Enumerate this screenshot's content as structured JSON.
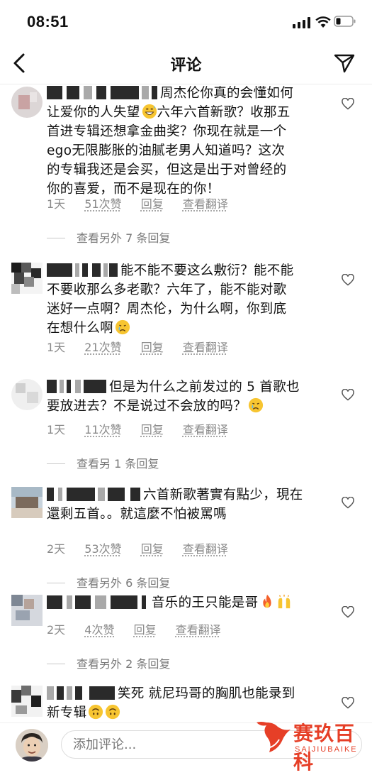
{
  "status_bar": {
    "time": "08:51"
  },
  "header": {
    "title": "评论",
    "back_icon": "chevron-left-icon",
    "share_icon": "paper-plane-icon"
  },
  "comments": [
    {
      "text_lines": [
        "周杰伦你真的会懂如何",
        "让爱你的人失望",
        "六年六首新歌？收那五",
        "首进专辑还想拿金曲奖？你现在就是一个",
        "ego无限膨胀的油腻老男人知道吗？这次",
        "的专辑我还是会买，但这是出于对曾经的",
        "你的喜爱，而不是现在的你！"
      ],
      "emoji": "grinning-sweat-emoji",
      "time": "1天",
      "likes": "51次赞",
      "reply": "回复",
      "translate": "查看翻译",
      "more_replies": "查看另外 7 条回复"
    },
    {
      "text_lines": [
        "能不能不要这么敷衍？能不能",
        "不要收那么多老歌？六年了，能不能对歌",
        "迷好一点啊？周杰伦，为什么啊，你到底",
        "在想什么啊"
      ],
      "emoji": "crying-face-emoji",
      "time": "1天",
      "likes": "21次赞",
      "reply": "回复",
      "translate": "查看翻译"
    },
    {
      "text_lines": [
        "但是为什么之前发过的 5 首歌也",
        "要放进去？不是说过不会放的吗？"
      ],
      "emoji": "crying-face-emoji",
      "time": "1天",
      "likes": "11次赞",
      "reply": "回复",
      "translate": "查看翻译",
      "more_replies": "查看另 1 条回复"
    },
    {
      "text_lines": [
        "六首新歌著實有點少，現在",
        "還剩五首。。就這麼不怕被罵嗎"
      ],
      "time": "2天",
      "likes": "53次赞",
      "reply": "回复",
      "translate": "查看翻译",
      "more_replies": "查看另外 6 条回复"
    },
    {
      "text_lines": [
        "音乐的王只能是哥"
      ],
      "emoji": "fire-emoji raising-hands-emoji",
      "time": "2天",
      "likes": "4次赞",
      "reply": "回复",
      "translate": "查看翻译",
      "more_replies": "查看另外 2 条回复"
    },
    {
      "text_lines": [
        "笑死 就尼玛哥的胸肌也能录到",
        "新专辑"
      ],
      "emoji": "upside-down-face-emoji upside-down-face-emoji"
    }
  ],
  "composer": {
    "placeholder": "添加评论..."
  },
  "watermark": {
    "brand_cn": "赛玖百科",
    "brand_en": "SAIJIUBAIKE"
  },
  "colors": {
    "text": "#111111",
    "meta": "#8a8a8a",
    "watermark": "#e63f27"
  }
}
